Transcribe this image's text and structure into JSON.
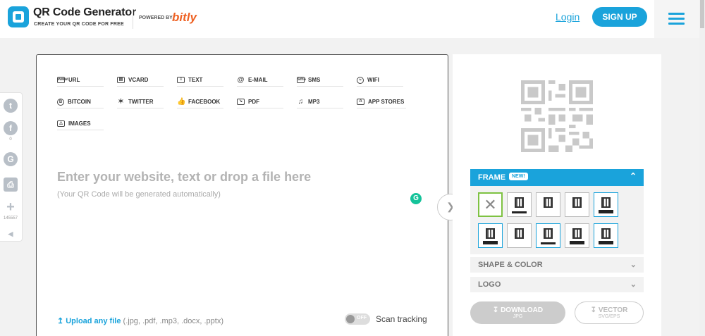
{
  "header": {
    "brand_title": "QR Code Generator",
    "brand_subtitle": "CREATE YOUR QR CODE FOR FREE",
    "powered_by": "POWERED BY",
    "powered_brand": "bitly",
    "login_label": "Login",
    "signup_label": "SIGN UP"
  },
  "social": {
    "facebook_count": "0",
    "share_count": "145557"
  },
  "qr_types": [
    {
      "label": "URL",
      "icon": "url-icon"
    },
    {
      "label": "VCARD",
      "icon": "vcard-icon"
    },
    {
      "label": "TEXT",
      "icon": "text-icon"
    },
    {
      "label": "E-MAIL",
      "icon": "email-icon"
    },
    {
      "label": "SMS",
      "icon": "sms-icon"
    },
    {
      "label": "WIFI",
      "icon": "wifi-icon"
    },
    {
      "label": "BITCOIN",
      "icon": "bitcoin-icon"
    },
    {
      "label": "TWITTER",
      "icon": "twitter-icon"
    },
    {
      "label": "FACEBOOK",
      "icon": "facebook-icon"
    },
    {
      "label": "PDF",
      "icon": "pdf-icon"
    },
    {
      "label": "MP3",
      "icon": "mp3-icon"
    },
    {
      "label": "APP STORES",
      "icon": "app-stores-icon"
    },
    {
      "label": "IMAGES",
      "icon": "images-icon"
    }
  ],
  "main": {
    "headline": "Enter your website, text or drop a file here",
    "subline": "(Your QR Code will be generated automatically)",
    "upload_link": "Upload any file",
    "upload_types": "(.jpg, .pdf, .mp3, .docx, .pptx)",
    "toggle_state": "OFF",
    "scan_tracking": "Scan tracking"
  },
  "right": {
    "frame_label": "FRAME",
    "new_badge": "NEW!",
    "shape_color_label": "SHAPE & COLOR",
    "logo_label": "LOGO",
    "download_label": "DOWNLOAD",
    "download_format": "JPG",
    "vector_label": "VECTOR",
    "vector_format": "SVG/EPS"
  },
  "colors": {
    "accent": "#1aa3db",
    "brand_orange": "#ee6123",
    "selected_green": "#7ec242"
  }
}
